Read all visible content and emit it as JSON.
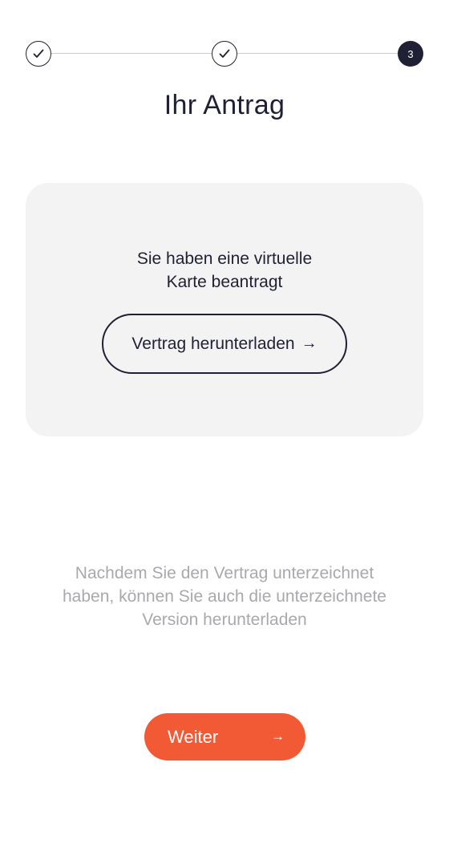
{
  "stepper": {
    "steps": [
      {
        "status": "done",
        "icon": "check-icon"
      },
      {
        "status": "done",
        "icon": "check-icon"
      },
      {
        "status": "current",
        "label": "3"
      }
    ]
  },
  "page": {
    "title": "Ihr Antrag"
  },
  "card": {
    "line1": "Sie haben eine virtuelle",
    "line2": "Karte beantragt",
    "download_label": "Vertrag herunterladen",
    "download_arrow": "→"
  },
  "info": {
    "line1": "Nachdem Sie den Vertrag unterzeichnet",
    "line2": "haben, können Sie auch die unterzeichnete",
    "line3": "Version herunterladen"
  },
  "footer": {
    "next_label": "Weiter",
    "next_arrow": "→"
  },
  "colors": {
    "accent": "#f25a36",
    "dark": "#1f2033",
    "muted": "#a9a9ad",
    "card_bg": "#f3f3f4"
  }
}
